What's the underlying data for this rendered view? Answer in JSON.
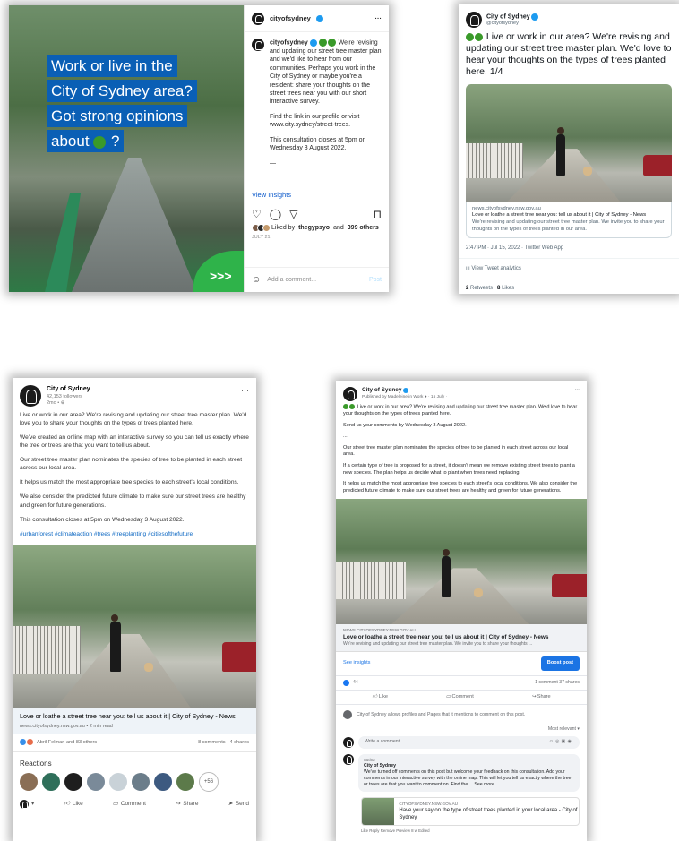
{
  "instagram": {
    "headline": [
      "Work or live in the",
      "City of Sydney area?",
      "Got strong opinions",
      "about",
      "?"
    ],
    "corner_arrows": ">>>",
    "username": "cityofsydney",
    "more": "···",
    "caption_text": "We're revising and updating our street tree master plan and we'd like to hear from our communities. Perhaps you work in the City of Sydney or maybe you're a resident: share your thoughts on the street trees near you with our short interactive survey.",
    "caption_p2": "Find the link in our profile or visit www.city.sydney/street-trees.",
    "caption_p3": "This consultation closes at 5pm on Wednesday 3 August 2022.",
    "caption_dash": "—",
    "view_insights": "View Insights",
    "liked_by_prefix": "Liked by",
    "liked_by_user": "thegypsyo",
    "liked_by_and": "and",
    "liked_by_count": "399 others",
    "date": "JULY 21",
    "comment_placeholder": "Add a comment...",
    "post_button": "Post"
  },
  "twitter": {
    "name": "City of Sydney",
    "handle": "@cityofsydney",
    "tweet_text": "Live or work in our area? We're revising and updating our street tree master plan. We'd love to hear your thoughts on the types of trees planted here. 1/4",
    "link_domain": "news.cityofsydney.nsw.gov.au",
    "link_title": "Love or loathe a street tree near you: tell us about it | City of Sydney - News",
    "link_desc": "We're revising and updating our street tree master plan. We invite you to share your thoughts on the types of trees planted in our area.",
    "meta": "2:47 PM · Jul 15, 2022 · Twitter Web App",
    "analytics": "View Tweet analytics",
    "retweets_count": "2",
    "retweets_label": "Retweets",
    "likes_count": "8",
    "likes_label": "Likes"
  },
  "linkedin": {
    "name": "City of Sydney",
    "followers": "42,153 followers",
    "time": "2mo • ",
    "more": "···",
    "p1": "Live or work in our area? We're revising and updating our street tree master plan. We'd love you to share your thoughts on the types of trees planted here.",
    "p2": "We've created an online map with an interactive survey so you can tell us exactly where the tree or trees are that you want to tell us about.",
    "p3": "Our street tree master plan nominates the species of tree to be planted in each street across our local area.",
    "p4": "It helps us match the most appropriate tree species to each street's local conditions.",
    "p5": "We also consider the predicted future climate to make sure our street trees are healthy and green for future generations.",
    "p6": "This consultation closes at 5pm on Wednesday 3 August 2022.",
    "tags": "#urbanforest #climateaction #trees #treeplanting #citiesofthefuture",
    "link_title": "Love or loathe a street tree near you: tell us about it | City of Sydney - News",
    "link_source": "news.cityofsydney.nsw.gov.au • 2 min read",
    "reactors": "Abril Felman and 83 others",
    "comments_shares": "8 comments · 4 shares",
    "reactions_heading": "Reactions",
    "more_reactions": "+56",
    "actions": [
      "Like",
      "Comment",
      "Share",
      "Send"
    ]
  },
  "facebook": {
    "name": "City of Sydney",
    "published_by": "Published by Madeleine in Work ● · 15 July ·",
    "more": "···",
    "p1": "Live or work in our area? We're revising and updating our street tree master plan. We'd love to hear your thoughts on the types of trees planted here.",
    "p2": "Send us your comments by Wednesday 3 August 2022.",
    "p3": "...",
    "p4": "Our street tree master plan nominates the species of tree to be planted in each street across our local area.",
    "p5": "If a certain type of tree is proposed for a street, it doesn't mean we remove existing street trees to plant a new species. The plan helps us decide what to plant when trees need replacing.",
    "p6": "It helps us match the most appropriate tree species to each street's local conditions. We also consider the predicted future climate to make sure our street trees are healthy and green for future generations.",
    "link_domain": "NEWS.CITYOFSYDNEY.NSW.GOV.AU",
    "link_title": "Love or loathe a street tree near you: tell us about it | City of Sydney - News",
    "link_desc": "We're revising and updating our street tree master plan. We invite you to share your thoughts ...",
    "see_insights": "See insights",
    "boost_post": "Boost post",
    "reaction_count": "44",
    "comments_shares": "1 comment  37 shares",
    "actions": [
      "Like",
      "Comment",
      "Share"
    ],
    "notice": "City of Sydney allows profiles and Pages that it mentions to comment on this post.",
    "most_relevant": "Most relevant ▾",
    "write_placeholder": "Write a comment...",
    "reply_author_tag": "Author",
    "reply_name": "City of Sydney",
    "reply_text": "We've turned off comments on this post but welcome your feedback on this consultation. Add your comments in our interactive survey with the online map. This will let you tell us exactly where the tree or trees are that you want to comment on. Find the ... See more",
    "reply_link_domain": "CITYOFSYDNEY.NSW.GOV.AU",
    "reply_link_title": "Have your say on the type of street trees planted in your local area - City of Sydney",
    "reply_footer": "Like  Reply  Remove Preview  8 w  Edited"
  }
}
